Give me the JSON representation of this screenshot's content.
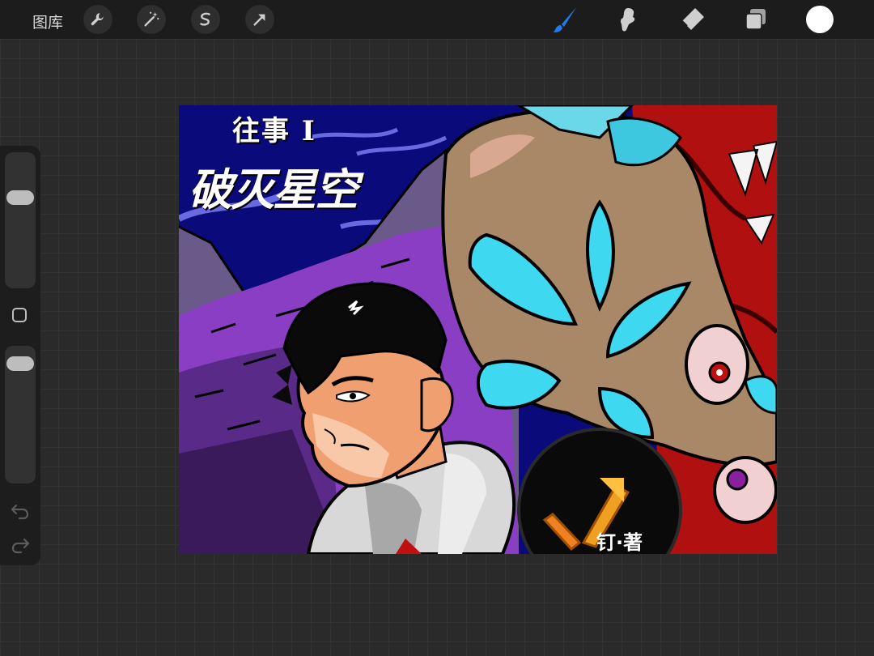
{
  "toolbar": {
    "gallery_label": "图库",
    "left_tools": [
      {
        "icon": "wrench-icon"
      },
      {
        "icon": "magic-wand-icon"
      },
      {
        "icon": "selection-icon"
      },
      {
        "icon": "transform-arrow-icon"
      }
    ],
    "right_tools": [
      {
        "icon": "brush-icon",
        "active": true
      },
      {
        "icon": "smudge-icon",
        "active": false
      },
      {
        "icon": "eraser-icon",
        "active": false
      },
      {
        "icon": "layers-icon",
        "active": false
      }
    ],
    "current_color": "#ffffff",
    "accent_color": "#1e7cf2"
  },
  "sidebar": {
    "brush_size_level": 0.7,
    "opacity_level": 0.05,
    "undo_icon": "undo-icon",
    "redo_icon": "redo-icon"
  },
  "artwork": {
    "title_line1": "往事 I",
    "title_line2": "破灭星空",
    "signature": "钉·著"
  }
}
